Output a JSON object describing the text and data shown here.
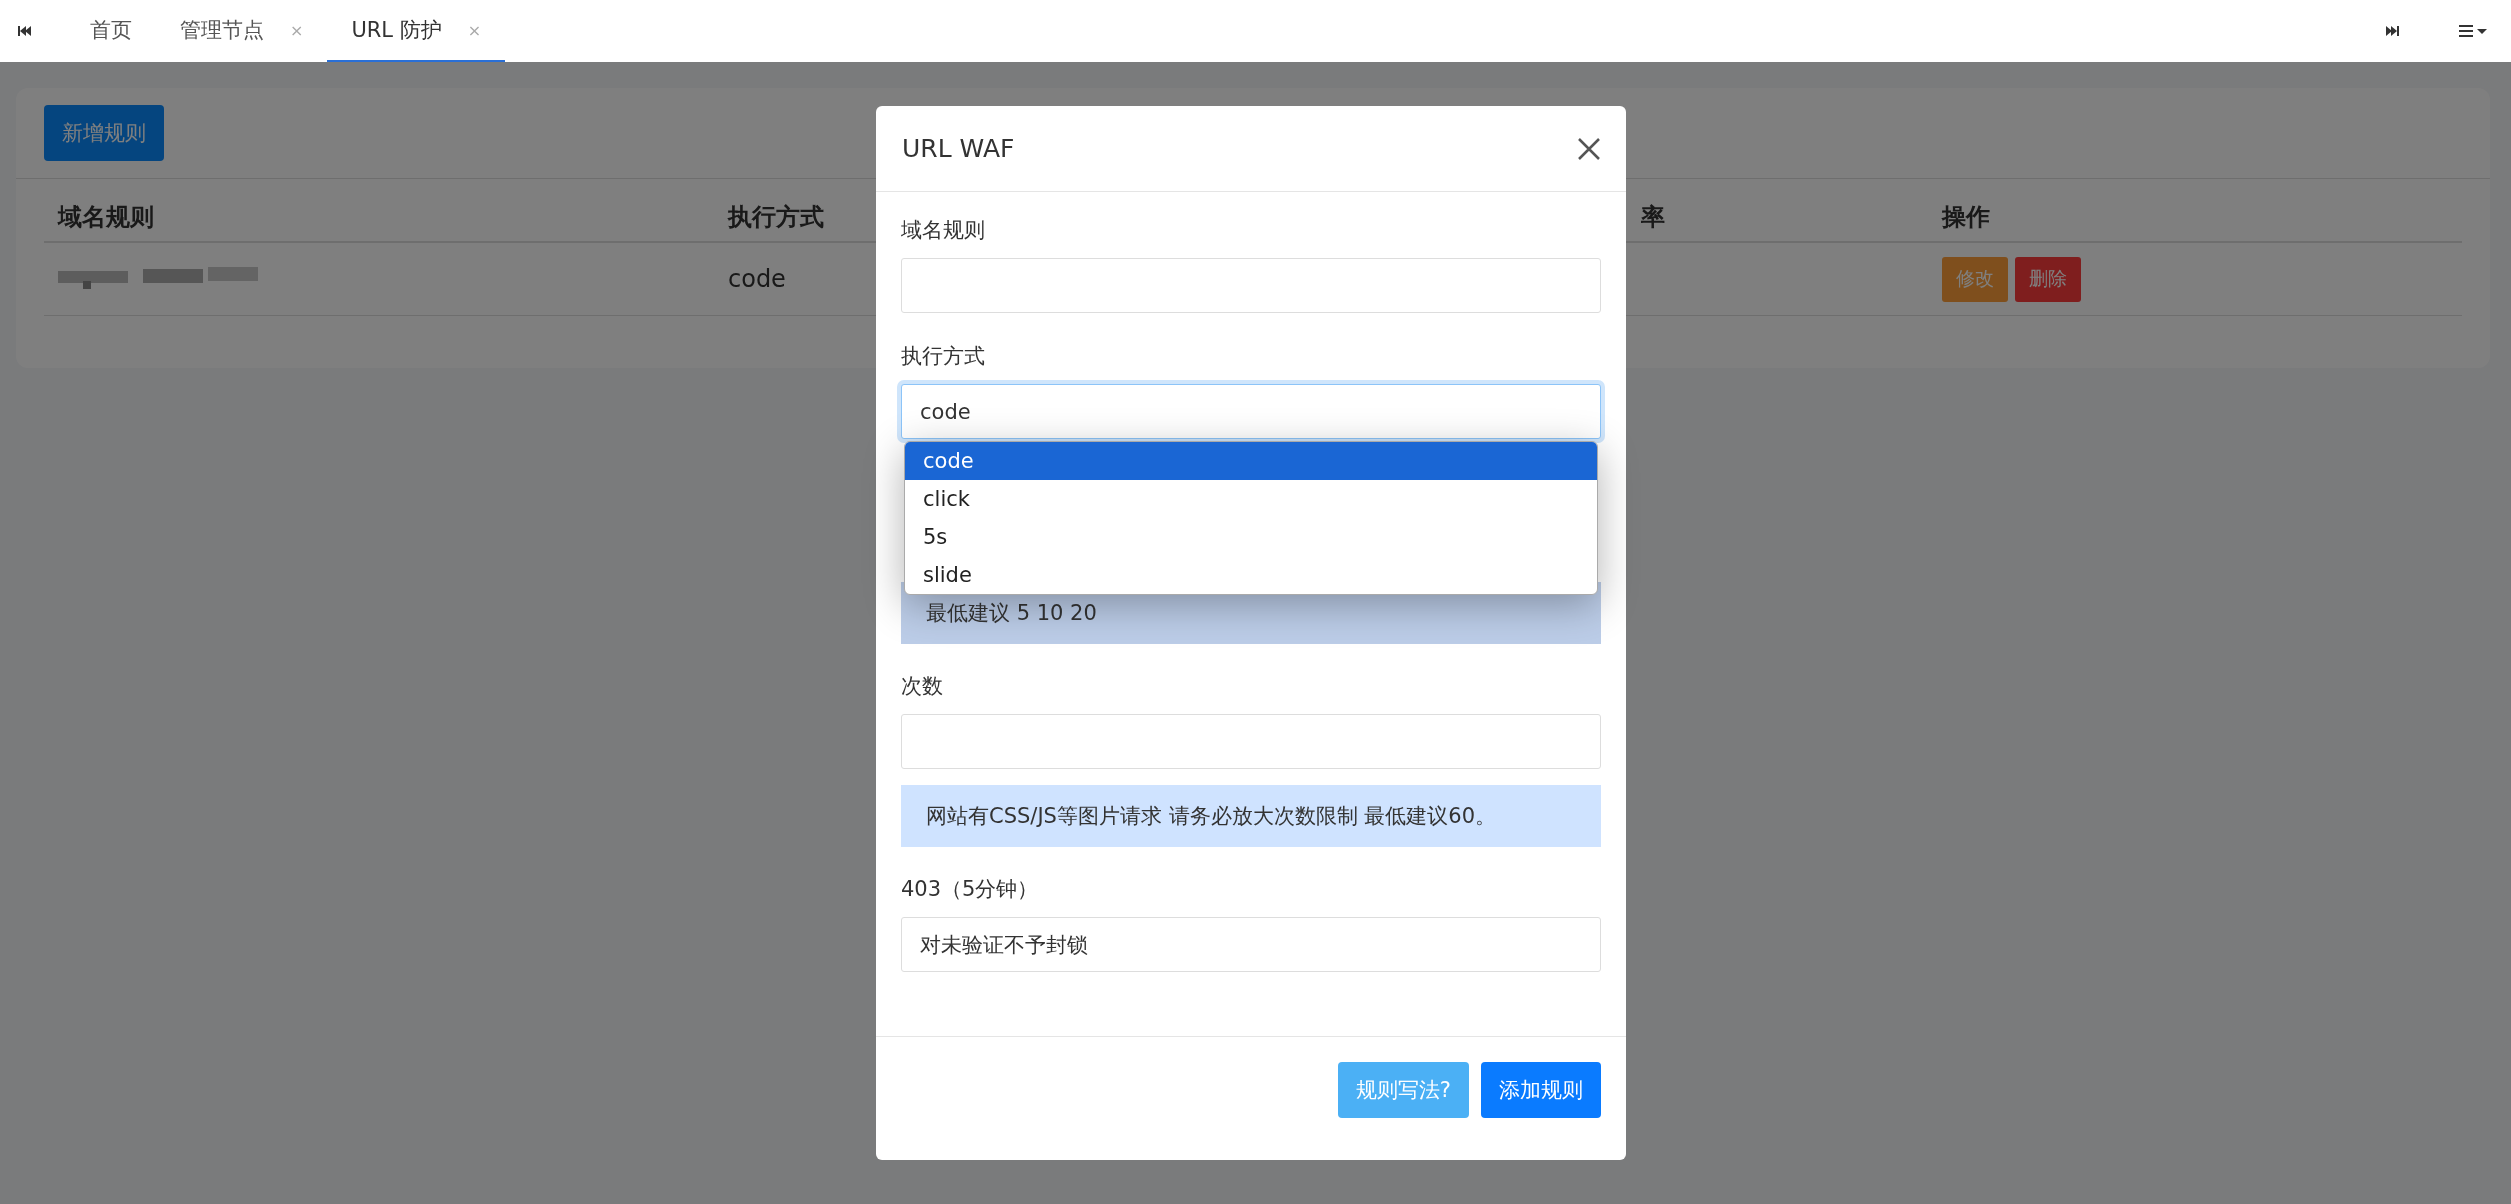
{
  "tabbar": {
    "tabs": [
      {
        "label": "首页",
        "selected": false
      },
      {
        "label": "管理节点",
        "close": "×",
        "selected": false
      },
      {
        "label": "URL 防护",
        "close": "×",
        "selected": true
      }
    ]
  },
  "page": {
    "add_button": "新增规则",
    "table": {
      "columns": [
        "域名规则",
        "执行方式",
        "率",
        "操作"
      ],
      "rows": [
        {
          "method": "code",
          "actions": [
            {
              "label": "修改",
              "kind": "warning"
            },
            {
              "label": "删除",
              "kind": "danger"
            }
          ]
        }
      ]
    }
  },
  "modal": {
    "title": "URL WAF",
    "domain_label": "域名规则",
    "method_label": "执行方式",
    "method_value": "code",
    "options": [
      {
        "label": "code",
        "selected": true
      },
      {
        "label": "click",
        "selected": false
      },
      {
        "label": "5s",
        "selected": false
      },
      {
        "label": "slide",
        "selected": false
      }
    ],
    "hint1": "最低建议 5 10 20",
    "count_label": "次数",
    "hint2": "网站有CSS/JS等图片请求 请务必放大次数限制 最低建议60。",
    "block_label": "403（5分钟）",
    "block_value": "对未验证不予封锁",
    "buttons": [
      {
        "label": "规则写法?",
        "kind": "info"
      },
      {
        "label": "添加规则",
        "kind": "primary"
      }
    ]
  }
}
